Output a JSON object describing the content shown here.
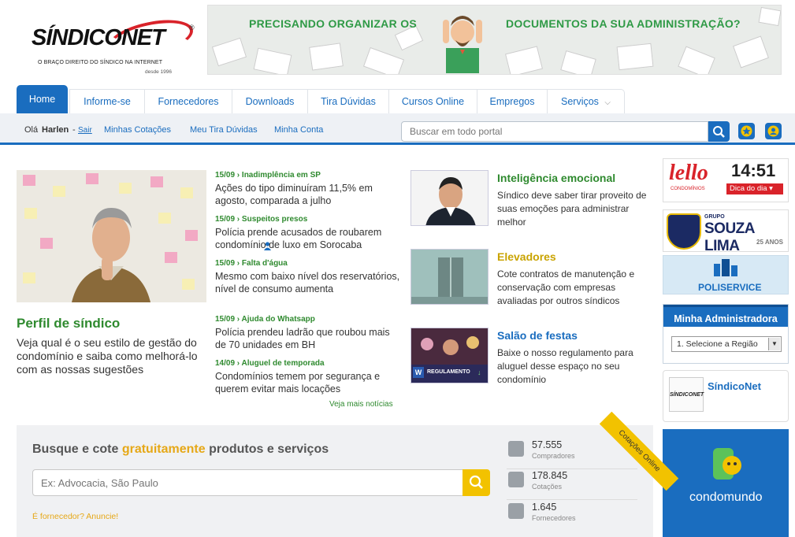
{
  "header": {
    "logo_text": "SÍNDICONET",
    "logo_reg": "®",
    "logo_tagline": "O BRAÇO DIREITO DO SÍNDICO NA INTERNET",
    "logo_since": "desde 1996",
    "banner_left": "PRECISANDO ORGANIZAR OS",
    "banner_right": "DOCUMENTOS DA SUA ADMINISTRAÇÃO?"
  },
  "nav": {
    "tabs": [
      "Home",
      "Informe-se",
      "Fornecedores",
      "Downloads",
      "Tira Dúvidas",
      "Cursos Online",
      "Empregos",
      "Serviços"
    ]
  },
  "userbar": {
    "greeting": "Olá",
    "username": "Harlen",
    "separator": "-",
    "logout": "Sair",
    "cotacoes": "Minhas Cotações",
    "tira_duvidas": "Meu Tira Dúvidas",
    "conta": "Minha Conta",
    "search_placeholder": "Buscar em todo portal"
  },
  "featured": {
    "title": "Perfil de síndico",
    "text": "Veja qual é o seu estilo de gestão do condomínio e saiba como melhorá-lo com as nossas sugestões"
  },
  "news": [
    {
      "date": "15/09 › Inadimplência em SP",
      "headline": "Ações do tipo diminuíram 11,5% em agosto, comparada a julho"
    },
    {
      "date": "15/09 › Suspeitos presos",
      "headline": "Polícia prende acusados de roubarem condomínio de luxo em Sorocaba"
    },
    {
      "date": "15/09 › Falta d'água",
      "headline": "Mesmo com baixo nível dos reservatórios, nível de consumo aumenta"
    },
    {
      "date": "15/09 › Ajuda do Whatsapp",
      "headline": "Polícia prendeu ladrão que roubou mais de 70 unidades em BH"
    },
    {
      "date": "14/09 › Aluguel de temporada",
      "headline": "Condomínios temem por segurança e querem evitar mais locações"
    }
  ],
  "news_more": "Veja mais notícias",
  "side_items": [
    {
      "title": "Inteligência emocional",
      "text": "Síndico deve saber tirar proveito de suas emoções para administrar melhor",
      "color": "#2f8a2f"
    },
    {
      "title": "Elevadores",
      "text": "Cote contratos de manutenção e conservação com empresas avaliadas por outros síndicos",
      "color": "#c9a300"
    },
    {
      "title": "Salão de festas",
      "text": "Baixe o nosso regulamento para aluguel desse espaço no seu condomínio",
      "color": "#1a6dbf",
      "badge": "REGULAMENTO"
    }
  ],
  "right": {
    "lello_logo": "lello",
    "lello_sub": "CONDOMÍNIOS",
    "time": "14:51",
    "dica": "Dica do dia",
    "souza_group": "GRUPO",
    "souza_name": "SOUZA LIMA",
    "souza_years": "25 ANOS",
    "poli": "POLISERVICE",
    "minha_title": "Minha Administradora",
    "minha_select": "1. Selecione a Região",
    "sndnet": "SíndicoNet",
    "condo": "condomundo"
  },
  "quote": {
    "title_a": "Busque e cote",
    "title_b": "gratuitamente",
    "title_c": "produtos e serviços",
    "placeholder": "Ex: Advocacia, São Paulo",
    "link": "É fornecedor? Anuncie!",
    "ribbon": "Cotações Online",
    "stats": [
      {
        "value": "57.555",
        "label": "Compradores"
      },
      {
        "value": "178.845",
        "label": "Cotações"
      },
      {
        "value": "1.645",
        "label": "Fornecedores"
      }
    ]
  }
}
